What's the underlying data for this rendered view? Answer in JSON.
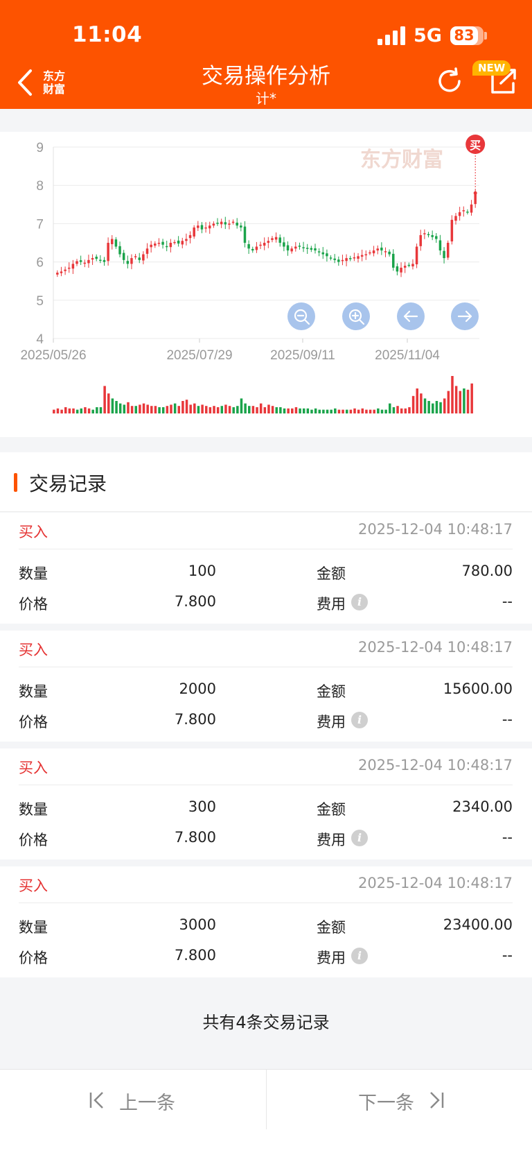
{
  "status_bar": {
    "time": "11:04",
    "network": "5G",
    "battery": "83",
    "battery_level": 0.83
  },
  "header": {
    "title": "交易操作分析",
    "subtitle": "计*",
    "logo_line1": "东方",
    "logo_line2": "财富",
    "new_badge": "NEW",
    "back_icon": "chevron-left-icon",
    "refresh_icon": "refresh-icon",
    "share_icon": "share-icon",
    "colors": {
      "bar": "#fd5300",
      "up": "#e8373a",
      "down": "#1aa34a",
      "accent": "#fd5300"
    }
  },
  "chart": {
    "watermark": "东方财富",
    "buy_marker": "买",
    "controls": [
      "zoom-out-icon",
      "zoom-in-icon",
      "arrow-left-icon",
      "arrow-right-icon"
    ]
  },
  "chart_data": {
    "type": "candlestick",
    "ylim": [
      4,
      9
    ],
    "yticks": [
      "9",
      "8",
      "7",
      "6",
      "5",
      "4"
    ],
    "xtick_labels": [
      "2025/05/26",
      "2025/07/29",
      "2025/09/11",
      "2025/11/04"
    ],
    "grid": true,
    "close_series": [
      5.72,
      5.75,
      5.8,
      5.85,
      5.95,
      6.02,
      6.0,
      5.98,
      6.05,
      6.1,
      6.08,
      6.05,
      6.0,
      6.5,
      6.6,
      6.4,
      6.2,
      6.05,
      5.95,
      6.1,
      6.15,
      6.05,
      6.2,
      6.35,
      6.45,
      6.48,
      6.5,
      6.45,
      6.4,
      6.5,
      6.52,
      6.48,
      6.55,
      6.6,
      6.7,
      6.9,
      6.95,
      6.85,
      6.9,
      6.95,
      7.0,
      7.02,
      7.05,
      6.98,
      7.0,
      7.05,
      6.95,
      6.9,
      6.5,
      6.35,
      6.3,
      6.4,
      6.45,
      6.5,
      6.55,
      6.62,
      6.65,
      6.5,
      6.4,
      6.3,
      6.35,
      6.4,
      6.42,
      6.38,
      6.35,
      6.32,
      6.3,
      6.25,
      6.2,
      6.15,
      6.1,
      6.05,
      6.0,
      6.05,
      6.1,
      6.08,
      6.12,
      6.15,
      6.18,
      6.2,
      6.25,
      6.3,
      6.35,
      6.3,
      6.28,
      6.2,
      5.85,
      5.75,
      5.85,
      5.9,
      5.92,
      5.95,
      6.4,
      6.7,
      6.75,
      6.7,
      6.65,
      6.6,
      6.3,
      6.1,
      6.5,
      7.1,
      7.2,
      7.3,
      7.35,
      7.3,
      7.5,
      7.8
    ],
    "volume_series": [
      3,
      4,
      3,
      5,
      4,
      4,
      3,
      4,
      5,
      4,
      3,
      5,
      5,
      22,
      16,
      12,
      10,
      8,
      7,
      9,
      6,
      6,
      7,
      8,
      7,
      6,
      6,
      5,
      5,
      6,
      7,
      8,
      6,
      10,
      11,
      7,
      8,
      6,
      7,
      6,
      5,
      6,
      5,
      6,
      7,
      6,
      5,
      6,
      12,
      8,
      6,
      6,
      5,
      8,
      5,
      7,
      6,
      5,
      5,
      4,
      4,
      4,
      5,
      4,
      4,
      4,
      3,
      4,
      3,
      3,
      3,
      3,
      4,
      3,
      3,
      3,
      3,
      4,
      3,
      4,
      3,
      3,
      3,
      4,
      3,
      3,
      8,
      5,
      6,
      4,
      4,
      5,
      14,
      20,
      16,
      12,
      10,
      8,
      10,
      9,
      12,
      18,
      30,
      22,
      18,
      20,
      19,
      24
    ]
  },
  "records_section": {
    "title": "交易记录"
  },
  "labels": {
    "qty": "数量",
    "amount": "金额",
    "price": "价格",
    "fee": "费用",
    "info_glyph": "i"
  },
  "records": [
    {
      "type": "买入",
      "time": "2025-12-04 10:48:17",
      "qty": "100",
      "amount": "780.00",
      "price": "7.800",
      "fee": "--"
    },
    {
      "type": "买入",
      "time": "2025-12-04 10:48:17",
      "qty": "2000",
      "amount": "15600.00",
      "price": "7.800",
      "fee": "--"
    },
    {
      "type": "买入",
      "time": "2025-12-04 10:48:17",
      "qty": "300",
      "amount": "2340.00",
      "price": "7.800",
      "fee": "--"
    },
    {
      "type": "买入",
      "time": "2025-12-04 10:48:17",
      "qty": "3000",
      "amount": "23400.00",
      "price": "7.800",
      "fee": "--"
    }
  ],
  "summary": "共有4条交易记录",
  "pager": {
    "prev": "上一条",
    "next": "下一条",
    "prev_icon": "first-page-icon",
    "next_icon": "last-page-icon"
  }
}
